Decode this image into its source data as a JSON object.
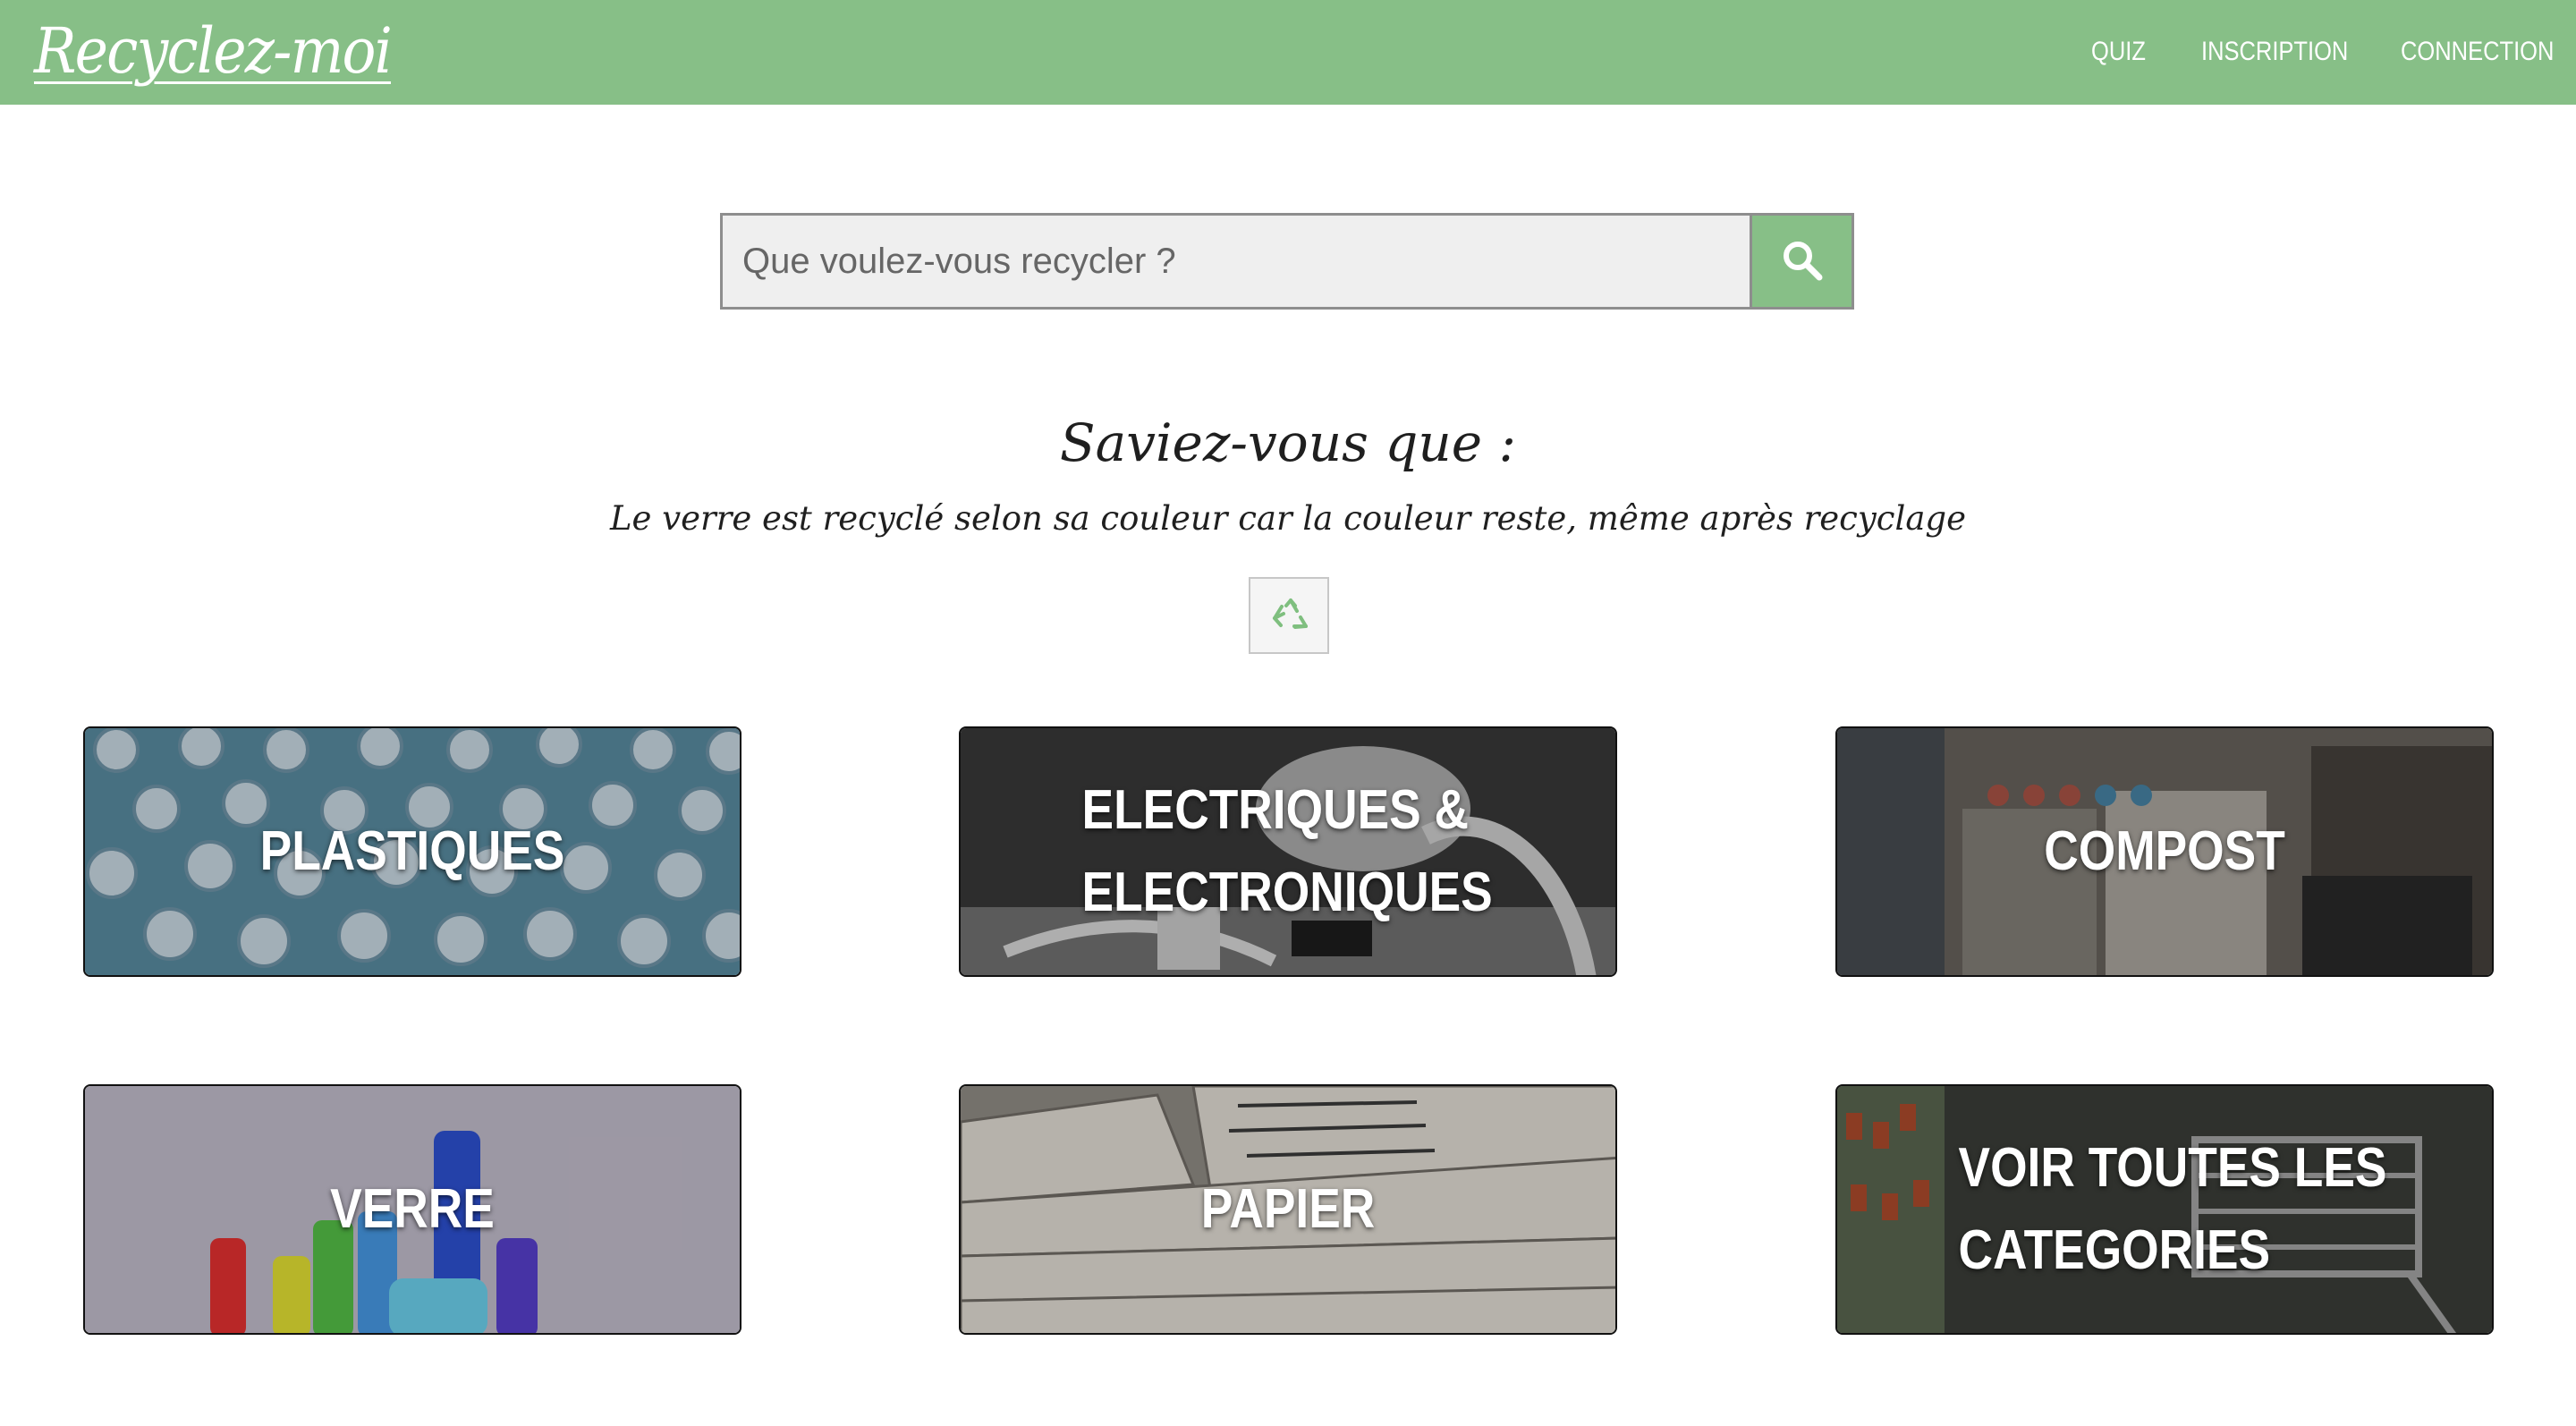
{
  "navbar": {
    "brand": "Recyclez-moi",
    "links": [
      "QUIZ",
      "INSCRIPTION",
      "CONNECTION"
    ]
  },
  "search": {
    "placeholder": "Que voulez-vous recycler ?"
  },
  "fact": {
    "title": "Saviez-vous que :",
    "text": "Le verre est recyclé selon sa couleur car la couleur reste, même après recyclage"
  },
  "categories": [
    {
      "label": "PLASTIQUES",
      "name": "card-plastiques"
    },
    {
      "label": "ELECTRIQUES & ELECTRONIQUES",
      "name": "card-electriques"
    },
    {
      "label": "COMPOST",
      "name": "card-compost"
    },
    {
      "label": "VERRE",
      "name": "card-verre"
    },
    {
      "label": "PAPIER",
      "name": "card-papier"
    },
    {
      "label": "VOIR TOUTES LES CATEGORIES",
      "name": "card-all-categories"
    }
  ],
  "colors": {
    "navbar": "#87bf87",
    "accent": "#87bf87",
    "recycle_icon": "#7fbf7f"
  }
}
